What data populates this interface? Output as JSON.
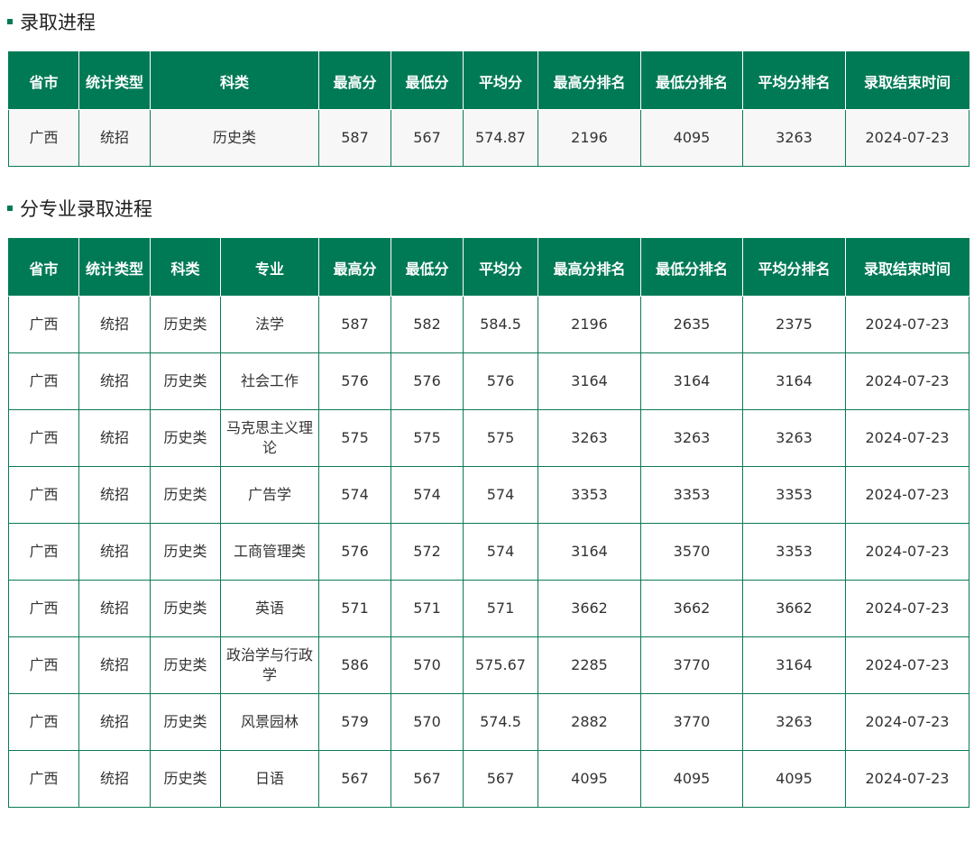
{
  "section1": {
    "title": "录取进程",
    "headers": [
      "省市",
      "统计类型",
      "科类",
      "最高分",
      "最低分",
      "平均分",
      "最高分排名",
      "最低分排名",
      "平均分排名",
      "录取结束时间"
    ],
    "rows": [
      [
        "广西",
        "统招",
        "历史类",
        "587",
        "567",
        "574.87",
        "2196",
        "4095",
        "3263",
        "2024-07-23"
      ]
    ]
  },
  "section2": {
    "title": "分专业录取进程",
    "headers": [
      "省市",
      "统计类型",
      "科类",
      "专业",
      "最高分",
      "最低分",
      "平均分",
      "最高分排名",
      "最低分排名",
      "平均分排名",
      "录取结束时间"
    ],
    "rows": [
      [
        "广西",
        "统招",
        "历史类",
        "法学",
        "587",
        "582",
        "584.5",
        "2196",
        "2635",
        "2375",
        "2024-07-23"
      ],
      [
        "广西",
        "统招",
        "历史类",
        "社会工作",
        "576",
        "576",
        "576",
        "3164",
        "3164",
        "3164",
        "2024-07-23"
      ],
      [
        "广西",
        "统招",
        "历史类",
        "马克思主义理论",
        "575",
        "575",
        "575",
        "3263",
        "3263",
        "3263",
        "2024-07-23"
      ],
      [
        "广西",
        "统招",
        "历史类",
        "广告学",
        "574",
        "574",
        "574",
        "3353",
        "3353",
        "3353",
        "2024-07-23"
      ],
      [
        "广西",
        "统招",
        "历史类",
        "工商管理类",
        "576",
        "572",
        "574",
        "3164",
        "3570",
        "3353",
        "2024-07-23"
      ],
      [
        "广西",
        "统招",
        "历史类",
        "英语",
        "571",
        "571",
        "571",
        "3662",
        "3662",
        "3662",
        "2024-07-23"
      ],
      [
        "广西",
        "统招",
        "历史类",
        "政治学与行政学",
        "586",
        "570",
        "575.67",
        "2285",
        "3770",
        "3164",
        "2024-07-23"
      ],
      [
        "广西",
        "统招",
        "历史类",
        "风景园林",
        "579",
        "570",
        "574.5",
        "2882",
        "3770",
        "3263",
        "2024-07-23"
      ],
      [
        "广西",
        "统招",
        "历史类",
        "日语",
        "567",
        "567",
        "567",
        "4095",
        "4095",
        "4095",
        "2024-07-23"
      ]
    ]
  }
}
